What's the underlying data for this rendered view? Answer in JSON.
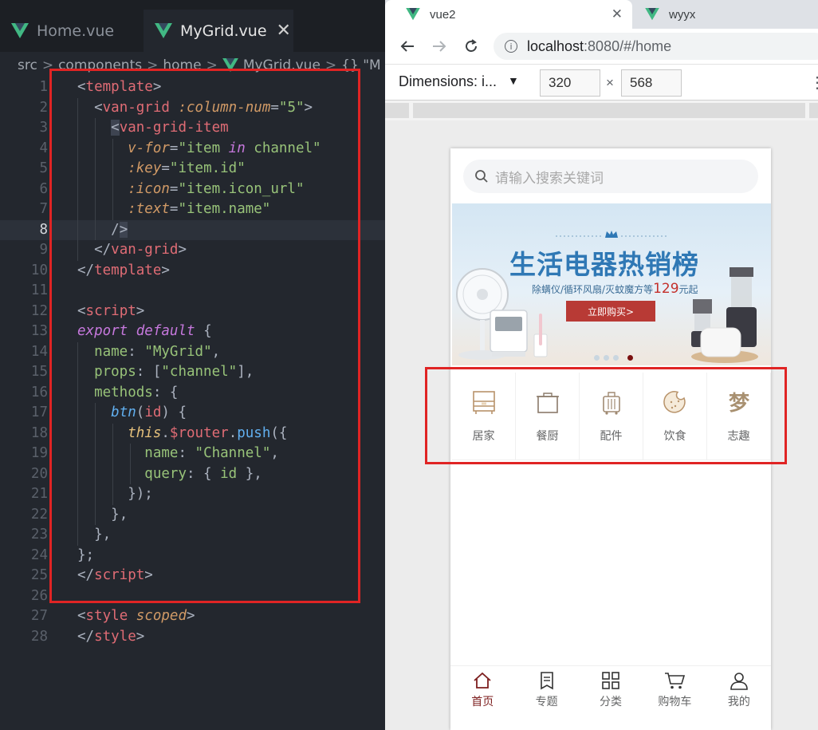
{
  "editor": {
    "tabs": [
      {
        "label": "Home.vue",
        "active": false
      },
      {
        "label": "MyGrid.vue",
        "active": true
      }
    ],
    "close_glyph": "✕",
    "breadcrumb": [
      "src",
      "components",
      "home",
      "MyGrid.vue",
      "{} \"M"
    ],
    "lines": [
      "1",
      "2",
      "3",
      "4",
      "5",
      "6",
      "7",
      "8",
      "9",
      "10",
      "11",
      "12",
      "13",
      "14",
      "15",
      "16",
      "17",
      "18",
      "19",
      "20",
      "21",
      "22",
      "23",
      "24",
      "25",
      "26",
      "27",
      "28"
    ],
    "current_line": "8"
  },
  "browser": {
    "tabs": [
      {
        "label": "vue2",
        "active": true,
        "close": "✕"
      },
      {
        "label": "wyyx",
        "active": false
      }
    ],
    "url_host": "localhost",
    "url_path": ":8080/#/home",
    "device": {
      "label": "Dimensions: i...",
      "width": "320",
      "height": "568",
      "times": "×"
    }
  },
  "mobile": {
    "search_placeholder": "请输入搜索关键词",
    "banner": {
      "title": "生活电器热销榜",
      "subtitle": "除螨仪/循环风扇/灭蚊魔方等",
      "price": "129",
      "price_suffix": "元起",
      "button": "立即购买>"
    },
    "grid": [
      {
        "label": "居家",
        "icon": "cabinet-icon"
      },
      {
        "label": "餐厨",
        "icon": "pot-icon"
      },
      {
        "label": "配件",
        "icon": "luggage-icon"
      },
      {
        "label": "饮食",
        "icon": "cookie-icon"
      },
      {
        "label": "志趣",
        "icon": "dream-icon"
      }
    ],
    "tabbar": [
      {
        "label": "首页",
        "icon": "home-icon",
        "active": true
      },
      {
        "label": "专题",
        "icon": "document-icon",
        "active": false
      },
      {
        "label": "分类",
        "icon": "category-icon",
        "active": false
      },
      {
        "label": "购物车",
        "icon": "cart-icon",
        "active": false
      },
      {
        "label": "我的",
        "icon": "user-icon",
        "active": false
      }
    ]
  },
  "colors": {
    "vue_green": "#41b883",
    "accent_red": "#7d1e1e",
    "highlight": "#e02424"
  }
}
